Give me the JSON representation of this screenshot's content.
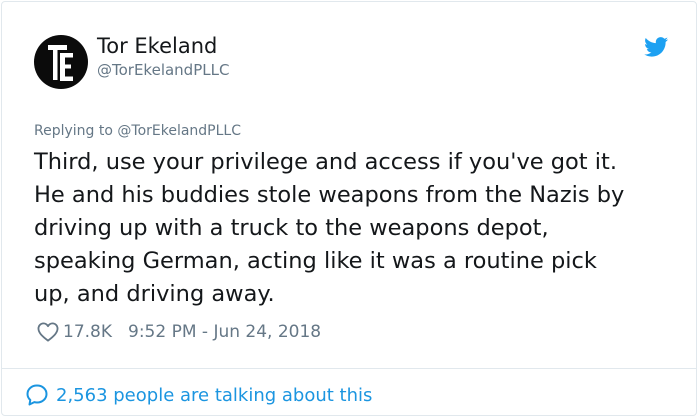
{
  "author": {
    "name": "Tor Ekeland",
    "handle": "@TorEkelandPLLC",
    "avatar_icon": "te-monogram-logo"
  },
  "brand_icon": "twitter-bird-icon",
  "reply": {
    "prefix": "Replying to",
    "handle": "@TorEkelandPLLC"
  },
  "tweet": {
    "lines": [
      "Third, use your privilege and access if you've got it.",
      "He and his buddies stole weapons from the Nazis by",
      "driving up with a truck to the weapons depot,",
      "speaking German, acting like it was a routine pick",
      "up, and driving away."
    ]
  },
  "meta": {
    "likes": "17.8K",
    "timestamp": "9:52 PM - Jun 24, 2018"
  },
  "conversation": {
    "label": "2,563 people are talking about this"
  },
  "colors": {
    "text": "#14171a",
    "muted": "#657786",
    "accent": "#1b95e0",
    "twitter_blue": "#1da1f2",
    "border": "#e1e8ed"
  }
}
